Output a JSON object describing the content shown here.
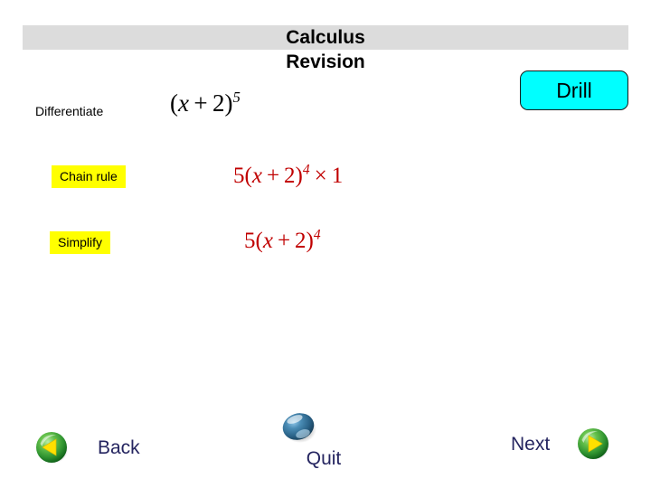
{
  "slide": {
    "title": "Calculus\nRevision",
    "title_band_color": "#dcdcdc",
    "background_color": "#ffffff"
  },
  "drill": {
    "label": "Drill",
    "fill_color": "#00ffff",
    "border_color": "#1a1a1a"
  },
  "steps": [
    {
      "label": "Differentiate",
      "highlighted": false,
      "expression": "(x + 2)⁵",
      "expression_color": "#000000"
    },
    {
      "label": "Chain rule",
      "highlighted": true,
      "highlight_color": "#ffff00",
      "expression": "5(x + 2)⁴ × 1",
      "expression_color": "#c00000"
    },
    {
      "label": "Simplify",
      "highlighted": true,
      "highlight_color": "#ffff00",
      "expression": "5(x + 2)⁴",
      "expression_color": "#c00000"
    }
  ],
  "nav": {
    "back": {
      "label": "Back",
      "icon": "green-sphere-left-arrow-icon",
      "sphere_color": "#2d9a2d",
      "arrow_color": "#ffe000"
    },
    "quit": {
      "label": "Quit",
      "icon": "blue-sphere-icon",
      "sphere_color": "#2c6f9b"
    },
    "next": {
      "label": "Next",
      "icon": "green-sphere-right-arrow-icon",
      "sphere_color": "#2d9a2d",
      "arrow_color": "#ffe000"
    },
    "label_color": "#252560"
  }
}
